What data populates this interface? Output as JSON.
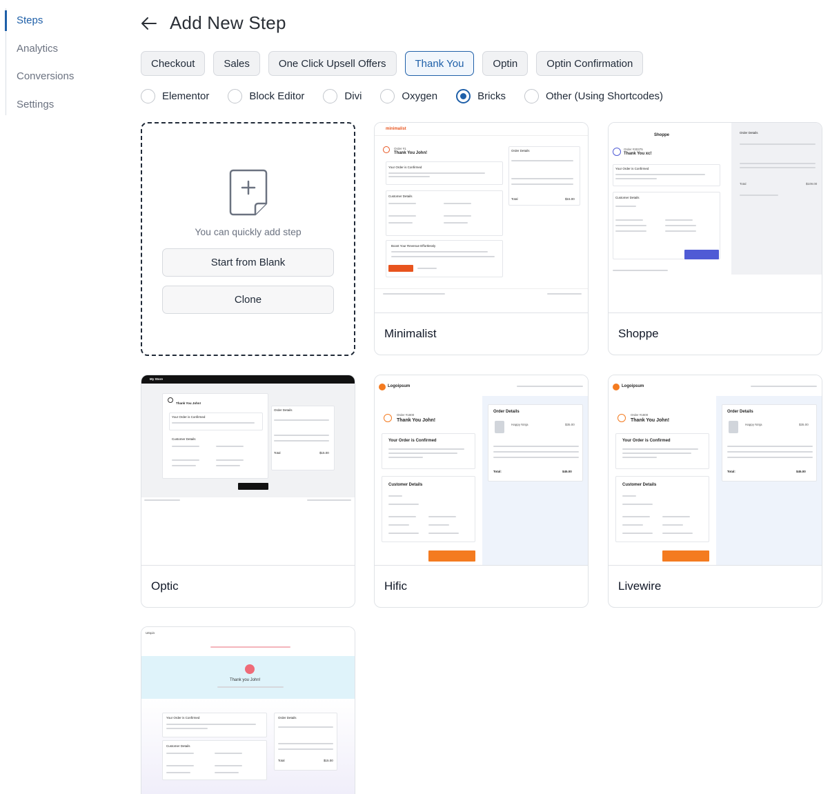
{
  "sidebar": {
    "items": [
      {
        "label": "Steps",
        "active": true
      },
      {
        "label": "Analytics",
        "active": false
      },
      {
        "label": "Conversions",
        "active": false
      },
      {
        "label": "Settings",
        "active": false
      }
    ]
  },
  "header": {
    "back_icon": "arrow-left-icon",
    "title": "Add New Step"
  },
  "tabs": [
    {
      "label": "Checkout",
      "active": false
    },
    {
      "label": "Sales",
      "active": false
    },
    {
      "label": "One Click Upsell Offers",
      "active": false
    },
    {
      "label": "Thank You",
      "active": true
    },
    {
      "label": "Optin",
      "active": false
    },
    {
      "label": "Optin Confirmation",
      "active": false
    }
  ],
  "builders": [
    {
      "label": "Elementor",
      "checked": false
    },
    {
      "label": "Block Editor",
      "checked": false
    },
    {
      "label": "Divi",
      "checked": false
    },
    {
      "label": "Oxygen",
      "checked": false
    },
    {
      "label": "Bricks",
      "checked": true
    },
    {
      "label": "Other (Using Shortcodes)",
      "checked": false
    }
  ],
  "blank_card": {
    "icon": "add-file-icon",
    "hint": "You can quickly add step",
    "start_blank_label": "Start from Blank",
    "clone_label": "Clone"
  },
  "templates": [
    {
      "name": "Minimalist",
      "preview": {
        "brand": "minimalist",
        "order_no": "Order #1",
        "thanks": "Thank You John!",
        "confirmed": "Your Order is Confirmed",
        "customer": "Customer Details",
        "order_details": "Order Details",
        "total_label": "Total",
        "total": "$15.00",
        "boost": "Boost Your Revenue Effortlessly",
        "accent": "#e8541e"
      }
    },
    {
      "name": "Shoppe",
      "preview": {
        "brand": "Shoppe",
        "order_no": "Order #30375",
        "thanks": "Thank You xc!",
        "confirmed": "Your Order is Confirmed",
        "customer": "Customer Details",
        "order_details": "Order Details",
        "total_label": "Total",
        "total": "$109.00",
        "button": "Continue Shopping",
        "accent": "#4f5bd5"
      }
    },
    {
      "name": "Optic",
      "preview": {
        "brand": "My Store",
        "thanks": "Thank You John!",
        "confirmed": "Your Order is Confirmed",
        "customer": "Customer Details",
        "order_details": "Order Details",
        "total_label": "Total",
        "total": "$15.00",
        "button": "Continue Shopping",
        "accent": "#111111"
      }
    },
    {
      "name": "Hific",
      "preview": {
        "brand": "Logoipsum",
        "order_no": "Order #1800",
        "thanks": "Thank You John!",
        "confirmed": "Your Order is Confirmed",
        "customer": "Customer Details",
        "order_details": "Order Details",
        "product": "Happy Ninja",
        "price": "$35.00",
        "total_label": "Total:",
        "total": "$45.00",
        "button": "Continue shopping",
        "accent": "#f47b20"
      }
    },
    {
      "name": "Livewire",
      "preview": {
        "brand": "Logoipsum",
        "order_no": "Order #1800",
        "thanks": "Thank You John!",
        "confirmed": "Your Order is Confirmed",
        "customer": "Customer Details",
        "order_details": "Order Details",
        "product": "Happy Ninja",
        "price": "$35.00",
        "total_label": "Total:",
        "total": "$45.00",
        "button": "Continue shopping",
        "accent": "#f47b20"
      }
    },
    {
      "name": "",
      "preview": {
        "brand": "Utopia",
        "thanks": "Thank you John!",
        "confirmed": "Your Order is Confirmed",
        "customer": "Customer Details",
        "order_details": "Order Details",
        "total_label": "Total",
        "total": "$15.00",
        "accent": "#ef6b78"
      }
    }
  ]
}
